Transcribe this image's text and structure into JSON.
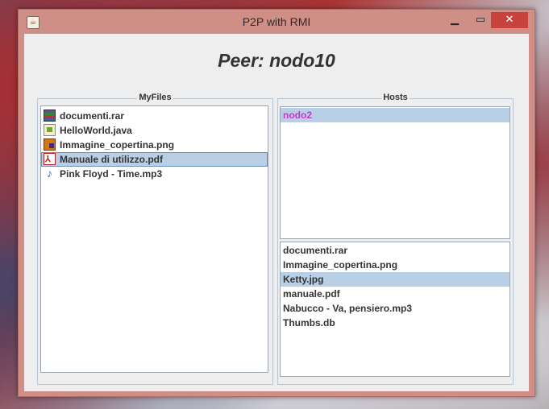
{
  "window": {
    "title": "P2P with RMI",
    "minimize_glyph": "▁",
    "maximize_glyph": "▭",
    "close_glyph": "✕"
  },
  "peer_title": "Peer: nodo10",
  "my_files": {
    "label": "MyFiles",
    "items": [
      {
        "name": "documenti.rar",
        "icon": "winrar-icon"
      },
      {
        "name": "HelloWorld.java",
        "icon": "java-file-icon"
      },
      {
        "name": "Immagine_copertina.png",
        "icon": "image-file-icon"
      },
      {
        "name": "Manuale di utilizzo.pdf",
        "icon": "pdf-file-icon",
        "selected": true
      },
      {
        "name": "Pink Floyd - Time.mp3",
        "icon": "audio-file-icon"
      }
    ]
  },
  "hosts": {
    "label": "Hosts",
    "items": [
      {
        "name": "nodo2",
        "selected": true
      }
    ]
  },
  "remote_files": {
    "items": [
      {
        "name": "documenti.rar"
      },
      {
        "name": "Immagine_copertina.png"
      },
      {
        "name": "Ketty.jpg",
        "selected": true
      },
      {
        "name": "manuale.pdf"
      },
      {
        "name": "Nabucco - Va, pensiero.mp3"
      },
      {
        "name": "Thumbs.db"
      }
    ]
  },
  "colors": {
    "titlebar": "#d08f86",
    "close_button": "#c7433b",
    "selection": "#b8cfe5",
    "host_text": "#cc33cc"
  }
}
